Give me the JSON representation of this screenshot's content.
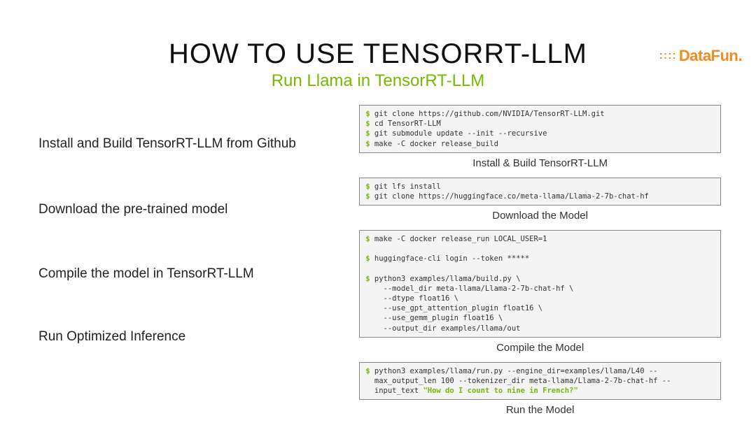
{
  "logo": {
    "prefix": "::::",
    "text": "DataFun",
    "suffix": "."
  },
  "title": "HOW TO USE TENSORRT-LLM",
  "subtitle": "Run Llama in TensorRT-LLM",
  "steps": [
    "Install and Build TensorRT-LLM from Github",
    "Download the pre-trained model",
    "Compile the model in TensorRT-LLM",
    "Run Optimized Inference"
  ],
  "blocks": [
    {
      "lines": [
        {
          "prompt": "$",
          "text": " git clone https://github.com/NVIDIA/TensorRT-LLM.git"
        },
        {
          "prompt": "$",
          "text": " cd TensorRT-LLM"
        },
        {
          "prompt": "$",
          "text": " git submodule update --init --recursive"
        },
        {
          "prompt": "$",
          "text": " make -C docker release_build"
        }
      ],
      "caption": "Install & Build TensorRT-LLM"
    },
    {
      "lines": [
        {
          "prompt": "$",
          "text": " git lfs install"
        },
        {
          "prompt": "$",
          "text": " git clone https://huggingface.co/meta-llama/Llama-2-7b-chat-hf"
        }
      ],
      "caption": "Download the Model"
    },
    {
      "lines": [
        {
          "prompt": "$",
          "text": " make -C docker release_run LOCAL_USER=1"
        },
        {
          "prompt": "",
          "text": ""
        },
        {
          "prompt": "$",
          "text": " huggingface-cli login --token *****"
        },
        {
          "prompt": "",
          "text": ""
        },
        {
          "prompt": "$",
          "text": " python3 examples/llama/build.py \\"
        },
        {
          "prompt": "",
          "text": "    --model_dir meta-llama/Llama-2-7b-chat-hf \\"
        },
        {
          "prompt": "",
          "text": "    --dtype float16 \\"
        },
        {
          "prompt": "",
          "text": "    --use_gpt_attention_plugin float16 \\"
        },
        {
          "prompt": "",
          "text": "    --use_gemm_plugin float16 \\"
        },
        {
          "prompt": "",
          "text": "    --output_dir examples/llama/out"
        }
      ],
      "caption": "Compile the Model"
    },
    {
      "lines": [
        {
          "prompt": "$",
          "text": " python3 examples/llama/run.py --engine_dir=examples/llama/L40 --"
        },
        {
          "prompt": "",
          "text": "  max_output_len 100 --tokenizer_dir meta-llama/Llama-2-7b-chat-hf --"
        },
        {
          "prompt": "",
          "text": "  input_text ",
          "hl": "\"How do I count to nine in French?\""
        }
      ],
      "caption": "Run the Model"
    }
  ]
}
